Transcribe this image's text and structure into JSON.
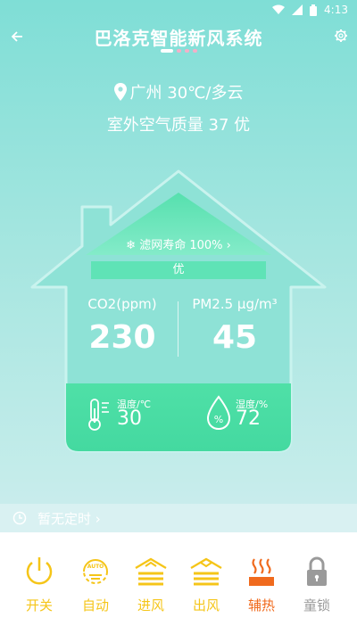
{
  "status_bar": {
    "time": "4:13"
  },
  "header": {
    "title": "巴洛克智能新风系统"
  },
  "location": {
    "text": "广州 30℃/多云"
  },
  "outdoor_air": {
    "text": "室外空气质量 37 优"
  },
  "filter": {
    "label": "滤网寿命 100%",
    "quality": "优"
  },
  "indoor": {
    "co2_label": "CO2(ppm)",
    "co2_value": "230",
    "pm_label": "PM2.5 μg/m³",
    "pm_value": "45",
    "temp_label": "温度/℃",
    "temp_value": "30",
    "humidity_label": "湿度/%",
    "humidity_value": "72"
  },
  "timer": {
    "text": "暂无定时"
  },
  "controls": [
    {
      "label": "开关",
      "icon": "power-icon",
      "color": "#f5c518"
    },
    {
      "label": "自动",
      "icon": "auto-icon",
      "color": "#f5c518"
    },
    {
      "label": "进风",
      "icon": "intake-icon",
      "color": "#f5c518"
    },
    {
      "label": "出风",
      "icon": "exhaust-icon",
      "color": "#f5c518"
    },
    {
      "label": "辅热",
      "icon": "heat-icon",
      "color": "#f06a1d"
    },
    {
      "label": "童锁",
      "icon": "lock-icon",
      "color": "#9a9a9a"
    }
  ]
}
